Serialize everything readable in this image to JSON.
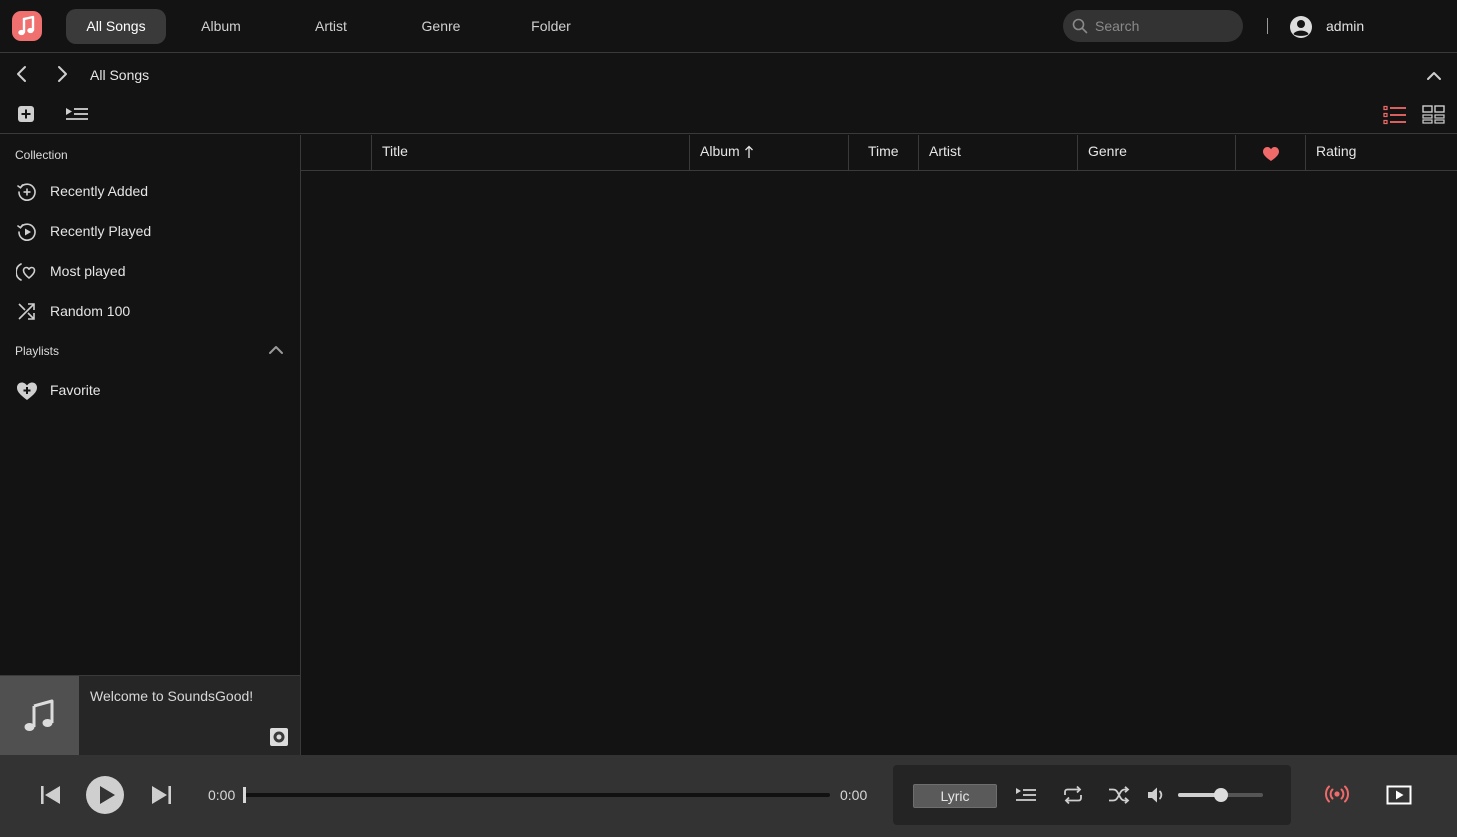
{
  "nav": {
    "tabs": [
      {
        "label": "All Songs",
        "active": true
      },
      {
        "label": "Album"
      },
      {
        "label": "Artist"
      },
      {
        "label": "Genre"
      },
      {
        "label": "Folder"
      }
    ],
    "search_placeholder": "Search",
    "username": "admin"
  },
  "subheader": {
    "breadcrumb": "All Songs"
  },
  "sidebar": {
    "collection_title": "Collection",
    "collection_items": [
      {
        "label": "Recently Added",
        "icon": "recently-added-icon"
      },
      {
        "label": "Recently Played",
        "icon": "recently-played-icon"
      },
      {
        "label": "Most played",
        "icon": "most-played-icon"
      },
      {
        "label": "Random 100",
        "icon": "shuffle-icon"
      }
    ],
    "playlists_title": "Playlists",
    "playlists": [
      {
        "label": "Favorite",
        "icon": "heart-playlist-icon"
      }
    ]
  },
  "now_playing": {
    "text": "Welcome to SoundsGood!"
  },
  "table": {
    "columns": [
      "",
      "Title",
      "Album",
      "Time",
      "Artist",
      "Genre",
      "",
      "Rating"
    ],
    "sort_column": "Album",
    "sort_direction": "ascending",
    "rows": []
  },
  "player": {
    "current_time": "0:00",
    "total_time": "0:00",
    "progress": 0.0,
    "volume": 0.5,
    "lyric_label": "Lyric"
  },
  "colors": {
    "accent": "#f06a6a",
    "background": "#131313",
    "player_bar": "#333333"
  }
}
